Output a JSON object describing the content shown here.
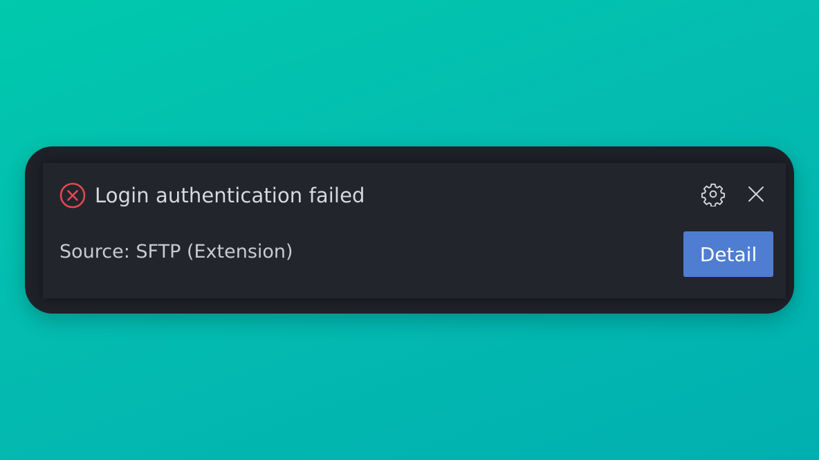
{
  "notification": {
    "title": "Login authentication failed",
    "source": "Source: SFTP (Extension)",
    "detail_label": "Detail",
    "icons": {
      "status": "error-circle-icon",
      "settings": "gear-icon",
      "close": "close-icon"
    }
  },
  "colors": {
    "background_from": "#00c9ad",
    "background_to": "#00b0b0",
    "toast": "#23252d",
    "error": "#e5484d",
    "button": "#4f7dd1",
    "text": "#d7d9de"
  }
}
